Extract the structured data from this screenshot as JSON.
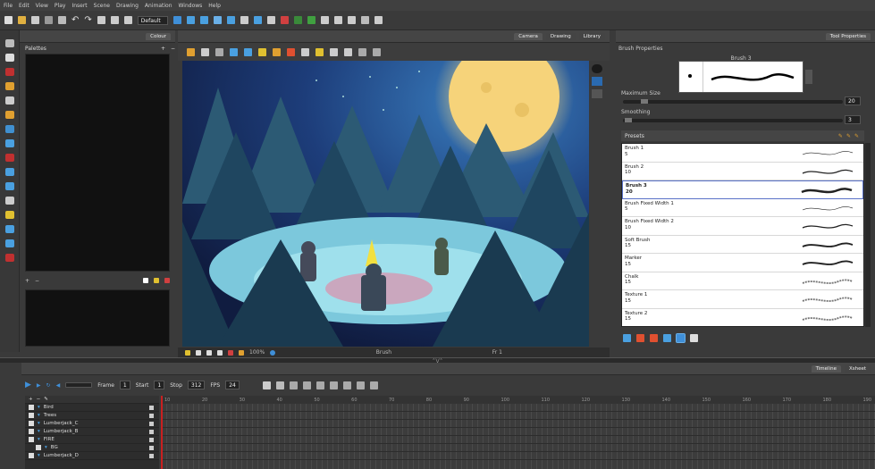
{
  "menubar": [
    "File",
    "Edit",
    "View",
    "Play",
    "Insert",
    "Scene",
    "Drawing",
    "Animation",
    "Windows",
    "Help"
  ],
  "toolbar": {
    "workspace": "Default"
  },
  "colour_panel": {
    "tab": "Colour",
    "palettes_label": "Palettes"
  },
  "viewport": {
    "tabs": [
      "Camera",
      "Drawing",
      "Library"
    ],
    "status_zoom": "100%",
    "status_tool": "Brush",
    "status_frame": "Fr 1"
  },
  "tool_properties": {
    "tab": "Tool Properties",
    "brush_properties_label": "Brush Properties",
    "brush_name": "Brush 3",
    "max_size_label": "Maximum Size",
    "max_size_value": "20",
    "smoothing_label": "Smoothing",
    "smoothing_value": "3",
    "presets_label": "Presets",
    "presets": [
      {
        "name": "Brush 1",
        "size": "5"
      },
      {
        "name": "Brush 2",
        "size": "10"
      },
      {
        "name": "Brush 3",
        "size": "20",
        "selected": true
      },
      {
        "name": "Brush Fixed Width 1",
        "size": "5"
      },
      {
        "name": "Brush Fixed Width 2",
        "size": "10"
      },
      {
        "name": "Soft Brush",
        "size": "15"
      },
      {
        "name": "Marker",
        "size": "15"
      },
      {
        "name": "Chalk",
        "size": "15"
      },
      {
        "name": "Texture 1",
        "size": "15"
      },
      {
        "name": "Texture 2",
        "size": "15"
      }
    ]
  },
  "timeline": {
    "tabs": [
      "Timeline",
      "Xsheet"
    ],
    "frame_label": "Frame",
    "frame_value": "1",
    "start_label": "Start",
    "start_value": "1",
    "stop_label": "Stop",
    "stop_value": "312",
    "fps_label": "FPS",
    "fps_value": "24",
    "ruler": [
      "10",
      "20",
      "30",
      "40",
      "50",
      "60",
      "70",
      "80",
      "90",
      "100",
      "110",
      "120",
      "130",
      "140",
      "150",
      "160",
      "170",
      "180",
      "190"
    ],
    "layers": [
      "Bird",
      "Trees",
      "Lumberjack_C",
      "Lumberjack_B",
      "FIRE",
      "BG",
      "Lumberjack_D"
    ]
  },
  "colors": {
    "accent": "#3f8fd8",
    "selection": "#5a72c8",
    "moon": "#f6d37a",
    "sky": "#1d3d7a",
    "playhead": "#c92020"
  }
}
